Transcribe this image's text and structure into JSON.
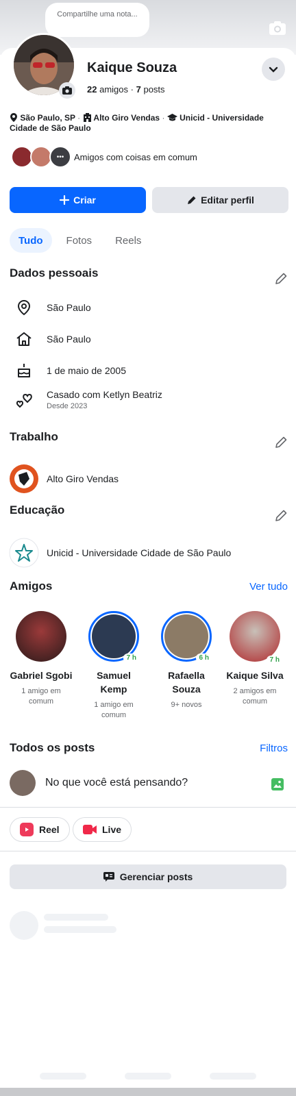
{
  "note": {
    "text": "Compartilhe uma nota..."
  },
  "profile": {
    "name": "Kaique Souza",
    "friends_count": "22",
    "friends_label": "amigos",
    "separator": "·",
    "posts_count": "7",
    "posts_label": "posts"
  },
  "intro": {
    "location": "São Paulo, SP",
    "work": "Alto Giro Vendas",
    "education": "Unicid - Universidade Cidade de São Paulo",
    "dot": "·"
  },
  "mutual": {
    "label": "Amigos com coisas em comum"
  },
  "buttons": {
    "create": "Criar",
    "edit": "Editar perfil"
  },
  "tabs": [
    {
      "label": "Tudo",
      "active": true
    },
    {
      "label": "Fotos",
      "active": false
    },
    {
      "label": "Reels",
      "active": false
    }
  ],
  "personal": {
    "title": "Dados pessoais",
    "current_city": "São Paulo",
    "hometown": "São Paulo",
    "birthday": "1 de maio de 2005",
    "relationship": "Casado com Ketlyn Beatriz",
    "relationship_since": "Desde 2023"
  },
  "work": {
    "title": "Trabalho",
    "company": "Alto Giro Vendas"
  },
  "education": {
    "title": "Educação",
    "school": "Unicid - Universidade Cidade de São Paulo"
  },
  "friends": {
    "title": "Amigos",
    "see_all": "Ver tudo",
    "items": [
      {
        "name": "Gabriel Sgobi",
        "sub": "1 amigo em comum",
        "badge": ""
      },
      {
        "name": "Samuel Kemp",
        "sub": "1 amigo em comum",
        "badge": "7 h"
      },
      {
        "name": "Rafaella Souza",
        "sub": "9+ novos",
        "badge": "6 h"
      },
      {
        "name": "Kaique Silva",
        "sub": "2 amigos em comum",
        "badge": "7 h"
      }
    ]
  },
  "posts": {
    "title": "Todos os posts",
    "filters": "Filtros",
    "composer_placeholder": "No que você está pensando?",
    "reel": "Reel",
    "live": "Live",
    "manage": "Gerenciar posts"
  },
  "colors": {
    "accent": "#0866ff",
    "button_grey": "#e4e6eb",
    "online_green": "#31a24c"
  },
  "icons": [
    "camera-icon",
    "chevron-down-icon",
    "location-pin-icon",
    "building-icon",
    "graduation-cap-icon",
    "plus-icon",
    "pencil-icon",
    "home-icon",
    "cake-icon",
    "hearts-icon",
    "star-icon",
    "photo-icon",
    "reel-icon",
    "video-camera-icon",
    "posts-icon"
  ]
}
